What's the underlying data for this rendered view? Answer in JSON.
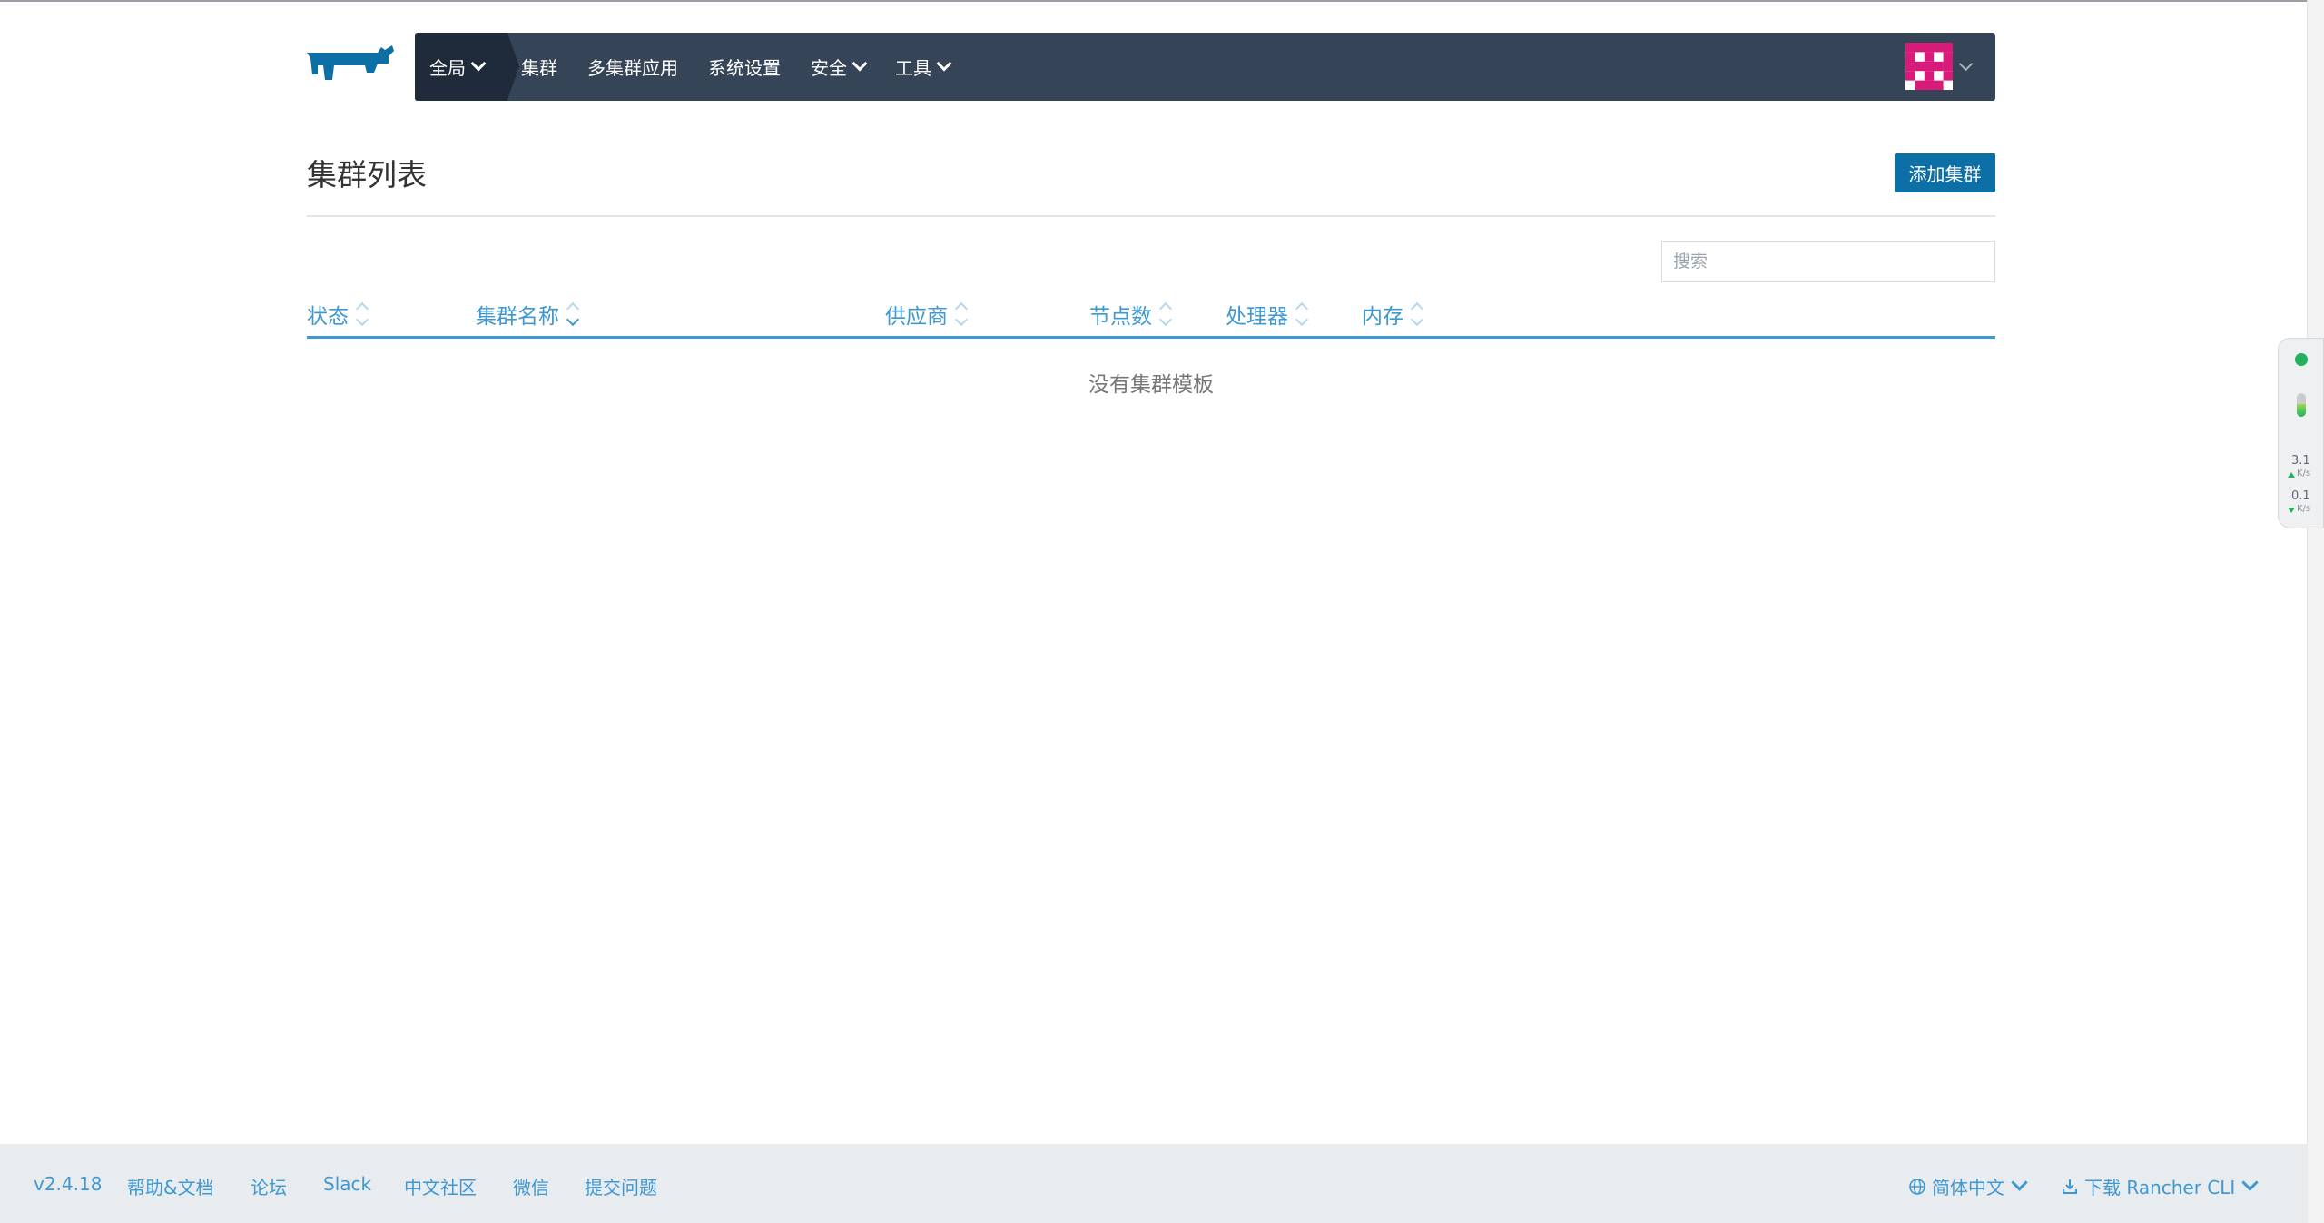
{
  "header": {
    "nav_global": "全局",
    "nav_items": [
      "集群",
      "多集群应用",
      "系统设置",
      "安全",
      "工具"
    ],
    "brand_color": "#0c6fa6",
    "navbar_color": "#364458"
  },
  "page": {
    "title": "集群列表",
    "add_button": "添加集群",
    "search_placeholder": "搜索"
  },
  "table": {
    "columns": [
      "状态",
      "集群名称",
      "供应商",
      "节点数",
      "处理器",
      "内存"
    ],
    "sorted_column": "集群名称",
    "empty_message": "没有集群模板"
  },
  "widget": {
    "upload_value": "3.1",
    "upload_unit": "K/s",
    "download_value": "0.1",
    "download_unit": "K/s",
    "status_color": "#20b35b"
  },
  "footer": {
    "version": "v2.4.18",
    "links": [
      "帮助&文档",
      "论坛",
      "Slack",
      "中文社区",
      "微信",
      "提交问题"
    ],
    "language": "简体中文",
    "download_cli": "下载 Rancher CLI"
  }
}
